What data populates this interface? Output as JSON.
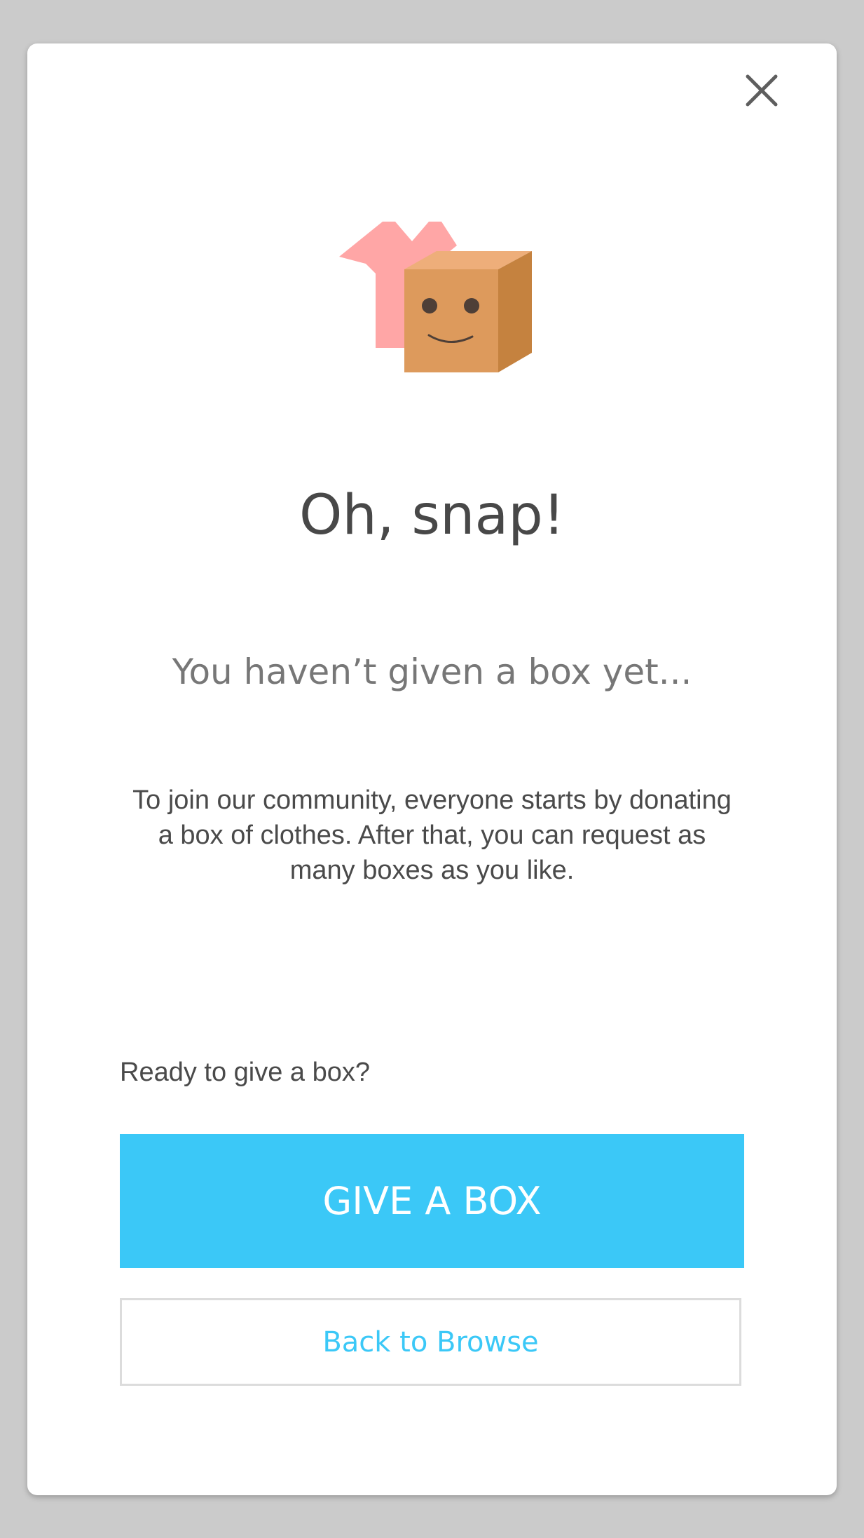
{
  "modal": {
    "close_icon": "close-icon",
    "illustration_icon": "box-with-shirt-icon",
    "title": "Oh, snap!",
    "subtitle": "You haven’t given a box yet...",
    "body": "To join our community, everyone starts by donating a box of clothes. After that, you can request as many boxes as you like.",
    "ready_label": "Ready to give a box?",
    "give_button_label": "GIVE A BOX",
    "back_button_label": "Back to Browse"
  },
  "colors": {
    "accent": "#3bc8f7",
    "shirt": "#ffa6a6",
    "box_front": "#dd9a5c",
    "box_top": "#eeae7a",
    "box_side": "#c5823f",
    "backdrop": "#cbcbcb"
  }
}
